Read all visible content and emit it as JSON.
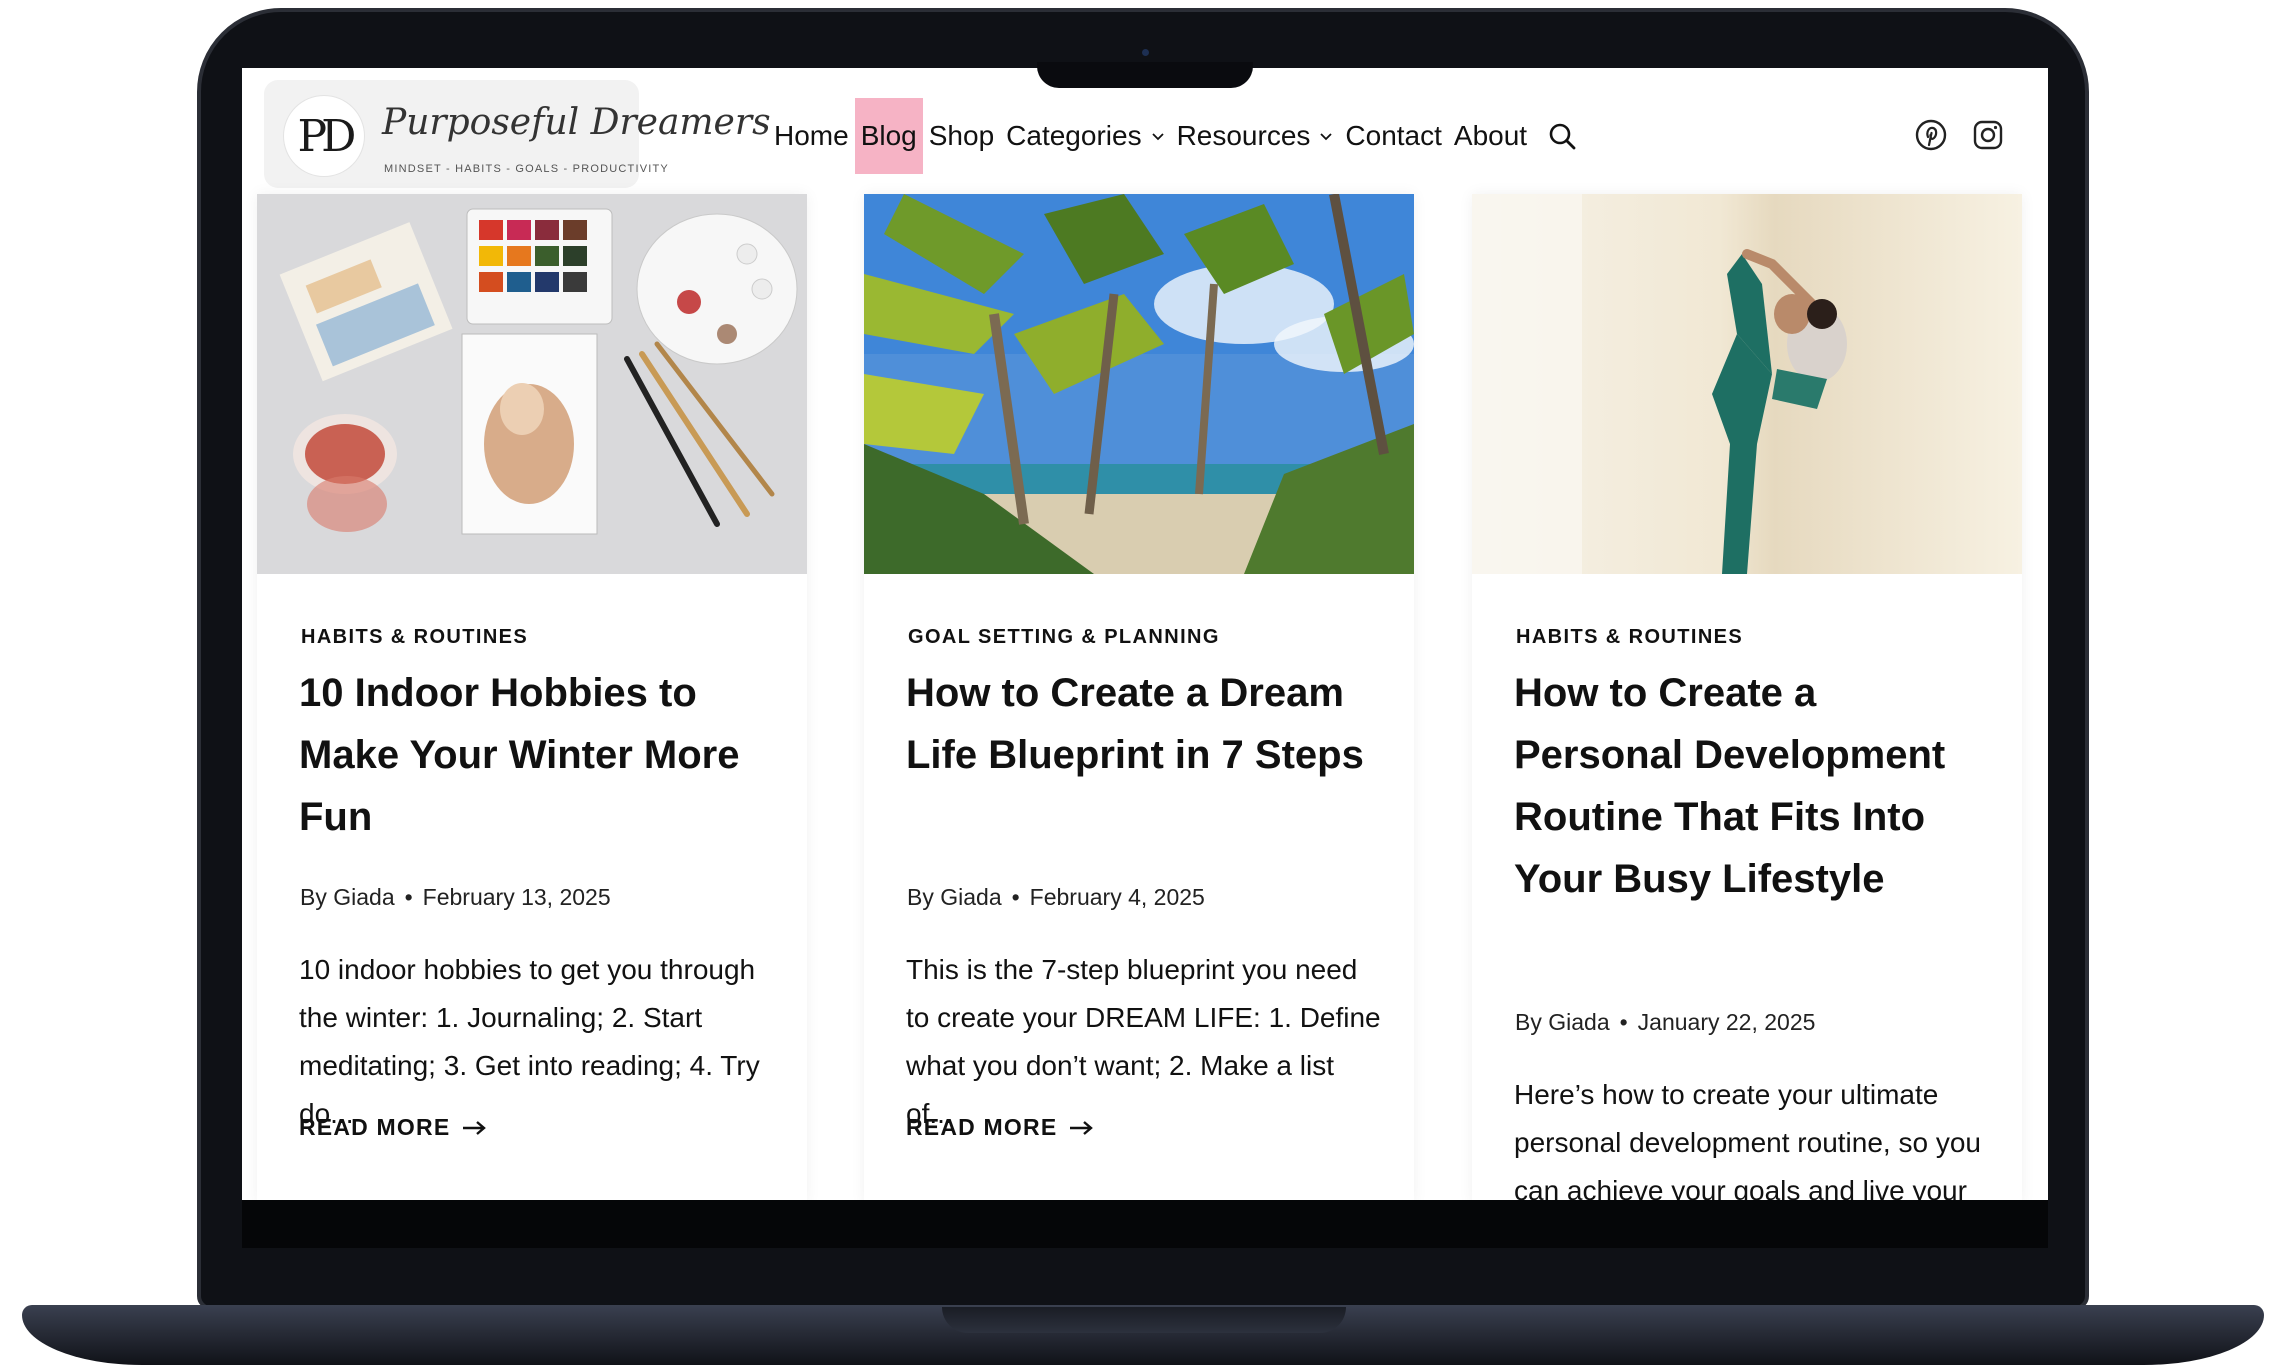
{
  "site": {
    "logo_monogram": "PD",
    "logo_script": "Purposeful Dreamers",
    "logo_tagline": "MINDSET - HABITS - GOALS - PRODUCTIVITY"
  },
  "nav": {
    "items": [
      {
        "label": "Home",
        "active": false,
        "dropdown": false
      },
      {
        "label": "Blog",
        "active": true,
        "dropdown": false
      },
      {
        "label": "Shop",
        "active": false,
        "dropdown": false
      },
      {
        "label": "Categories",
        "active": false,
        "dropdown": true
      },
      {
        "label": "Resources",
        "active": false,
        "dropdown": true
      },
      {
        "label": "Contact",
        "active": false,
        "dropdown": false
      },
      {
        "label": "About",
        "active": false,
        "dropdown": false
      }
    ],
    "icons": [
      "search-icon",
      "pinterest-icon",
      "instagram-icon"
    ],
    "active_color": "#f6b3c5"
  },
  "posts": [
    {
      "category": "HABITS & ROUTINES",
      "title": "10 Indoor Hobbies to Make Your Winter More Fun",
      "author": "By Giada",
      "date": "February 13, 2025",
      "excerpt": "10 indoor hobbies to get you through the winter: 1. Journaling; 2. Start meditating; 3. Get into reading; 4. Try do...",
      "read_more": "READ MORE",
      "image": "watercolor-paint-set-photo"
    },
    {
      "category": "GOAL SETTING & PLANNING",
      "title": "How to Create a Dream Life Blueprint in 7 Steps",
      "author": "By Giada",
      "date": "February 4, 2025",
      "excerpt": "This is the 7-step blueprint you need to create your DREAM LIFE: 1. Define what you don’t want; 2. Make a list of...",
      "read_more": "READ MORE",
      "image": "tropical-palm-beach-photo"
    },
    {
      "category": "HABITS & ROUTINES",
      "title": "How to Create a Personal Development Routine That Fits Into Your Busy Lifestyle",
      "author": "By Giada",
      "date": "January 22, 2025",
      "excerpt": "Here’s how to create your ultimate personal development routine, so you can achieve your goals and live your dream life.",
      "image": "yoga-dancer-pose-photo"
    }
  ]
}
